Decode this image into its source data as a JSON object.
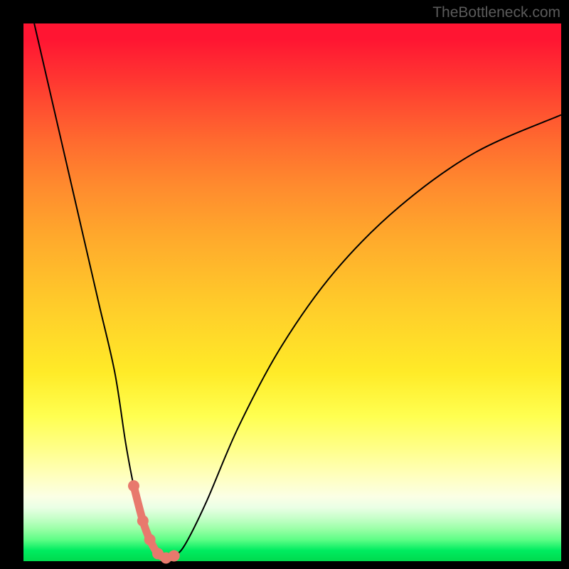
{
  "attribution": "TheBottleneck.com",
  "chart_data": {
    "type": "line",
    "title": "",
    "xlabel": "",
    "ylabel": "",
    "xlim": [
      0,
      100
    ],
    "ylim": [
      0,
      100
    ],
    "series": [
      {
        "name": "bottleneck-curve",
        "x": [
          2,
          5,
          8,
          11,
          14,
          17,
          19,
          20.5,
          22,
          23.5,
          25,
          26.5,
          28,
          30,
          34,
          40,
          48,
          58,
          70,
          84,
          100
        ],
        "values": [
          100,
          87,
          74,
          61,
          48,
          35,
          22,
          14,
          8,
          4,
          1.4,
          0.6,
          1.0,
          3,
          11,
          25,
          40,
          54,
          66,
          76,
          83
        ]
      }
    ],
    "markers": {
      "name": "highlight-dots",
      "x": [
        20.5,
        22.2,
        23.5,
        25.0,
        26.5,
        28.0
      ],
      "values": [
        14,
        7.5,
        4.0,
        1.4,
        0.6,
        1.0
      ]
    },
    "gradient": {
      "top_color": "#ff1532",
      "bottom_color": "#00da4e"
    }
  }
}
